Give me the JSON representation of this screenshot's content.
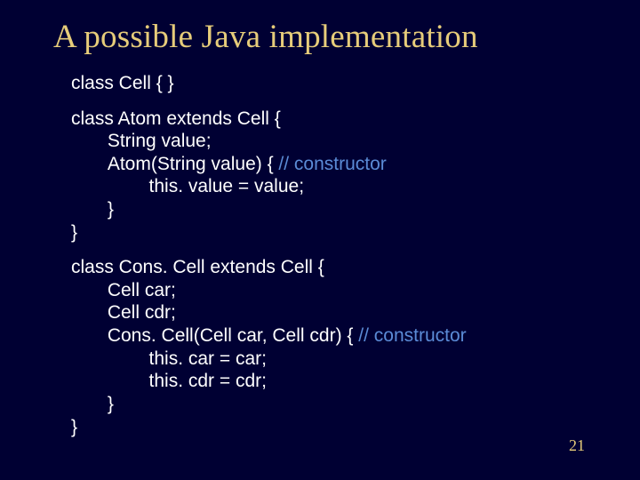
{
  "title": "A possible Java implementation",
  "code": {
    "b1_l1": "class Cell { }",
    "b2_l1": "class Atom extends Cell {",
    "b2_l2": "       String value;",
    "b2_l3a": "       Atom(String value) { ",
    "b2_l3b": "// constructor",
    "b2_l4": "               this. value = value;",
    "b2_l5": "       }",
    "b2_l6": "}",
    "b3_l1": "class Cons. Cell extends Cell {",
    "b3_l2": "       Cell car;",
    "b3_l3": "       Cell cdr;",
    "b3_l4a": "       Cons. Cell(Cell car, Cell cdr) { ",
    "b3_l4b": "// constructor",
    "b3_l5": "               this. car = car;",
    "b3_l6": "               this. cdr = cdr;",
    "b3_l7": "       }",
    "b3_l8": "}"
  },
  "page_number": "21"
}
